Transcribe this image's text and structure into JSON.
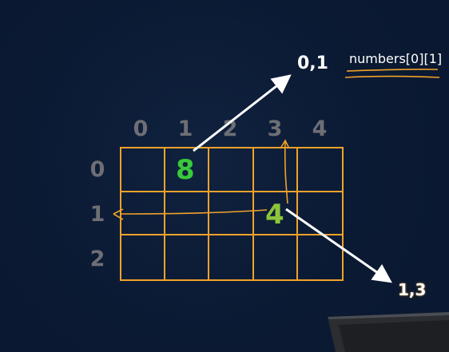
{
  "column_labels": [
    "0",
    "1",
    "2",
    "3",
    "4"
  ],
  "row_labels": [
    "0",
    "1",
    "2"
  ],
  "cells": {
    "r0c1": "8",
    "r1c3": "4"
  },
  "coordinates": {
    "top": "0,1",
    "bottom": "1,3"
  },
  "code_text": "numbers[0][1]",
  "colors": {
    "background": "#0b1a33",
    "grid": "#f2a22a",
    "labels_muted": "#6d6f75",
    "value_eight": "#39c93a",
    "value_four": "#8bc63a",
    "annotation": "#f2a22a",
    "arrow": "#ffffff"
  }
}
